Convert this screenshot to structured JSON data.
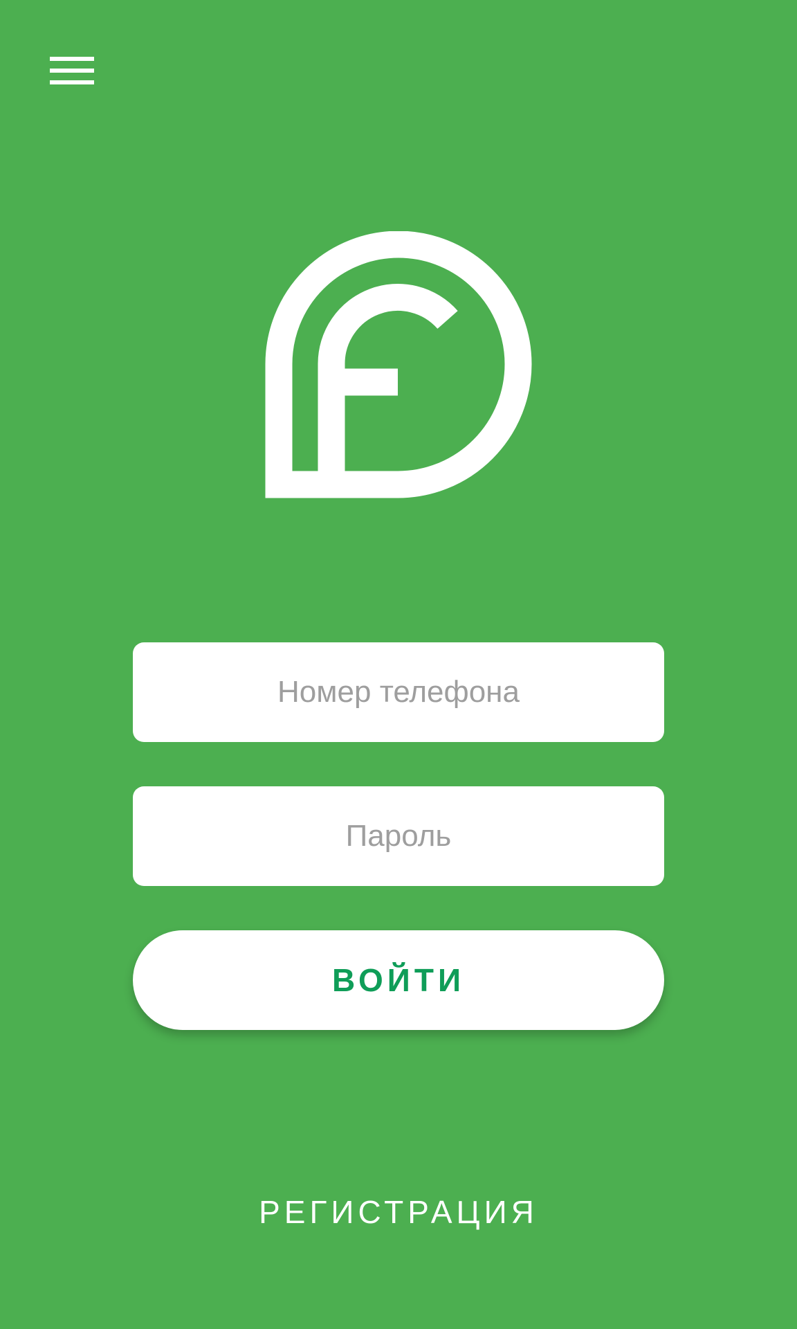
{
  "header": {
    "menu_icon": "hamburger-menu-icon"
  },
  "logo": {
    "icon": "app-logo-f-icon"
  },
  "login_form": {
    "phone_placeholder": "Номер телефона",
    "phone_value": "",
    "password_placeholder": "Пароль",
    "password_value": "",
    "login_label": "ВОЙТИ"
  },
  "footer": {
    "register_label": "РЕГИСТРАЦИЯ"
  },
  "colors": {
    "background": "#4caf50",
    "accent": "#0f9d58",
    "surface": "#ffffff",
    "placeholder": "#9e9e9e"
  }
}
